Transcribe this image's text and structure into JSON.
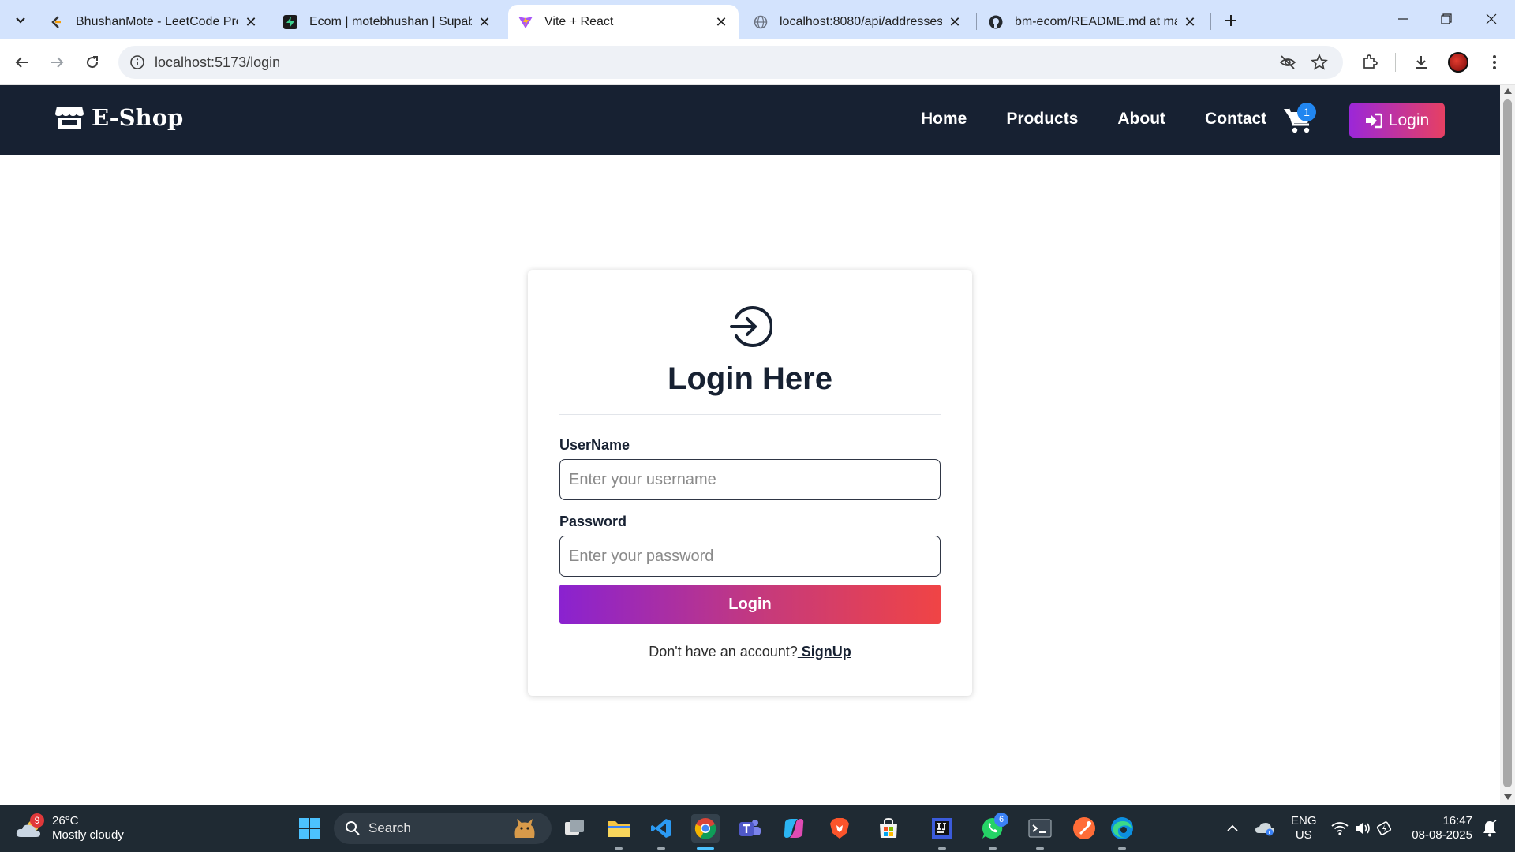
{
  "browser": {
    "tabs": [
      {
        "title": "BhushanMote - LeetCode Profil",
        "favicon": "leetcode-icon"
      },
      {
        "title": "Ecom | motebhushan | Supabas",
        "favicon": "supabase-icon"
      },
      {
        "title": "Vite + React",
        "favicon": "vite-icon",
        "active": true
      },
      {
        "title": "localhost:8080/api/addresses",
        "favicon": "globe-icon"
      },
      {
        "title": "bm-ecom/README.md at main",
        "favicon": "github-icon"
      }
    ],
    "url": "localhost:5173/login"
  },
  "navbar": {
    "brand": "E-Shop",
    "links": [
      "Home",
      "Products",
      "About",
      "Contact"
    ],
    "cart_count": "1",
    "login_label": "Login"
  },
  "login": {
    "title": "Login Here",
    "username_label": "UserName",
    "username_placeholder": "Enter your username",
    "password_label": "Password",
    "password_placeholder": "Enter your password",
    "submit_label": "Login",
    "signup_prompt": "Don't have an account?",
    "signup_link": " SignUp"
  },
  "taskbar": {
    "weather_temp": "26°C",
    "weather_desc": "Mostly cloudy",
    "weather_badge": "9",
    "search_label": "Search",
    "whatsapp_badge": "6",
    "lang_1": "ENG",
    "lang_2": "US",
    "time": "16:47",
    "date": "08-08-2025"
  },
  "colors": {
    "navbar_bg": "#172132",
    "tabstrip_bg": "#d3e3fd",
    "button_gradient_start": "#8a22d0",
    "button_gradient_end": "#f04445",
    "cart_badge": "#2186f0",
    "taskbar_bg": "#1f2a33"
  }
}
